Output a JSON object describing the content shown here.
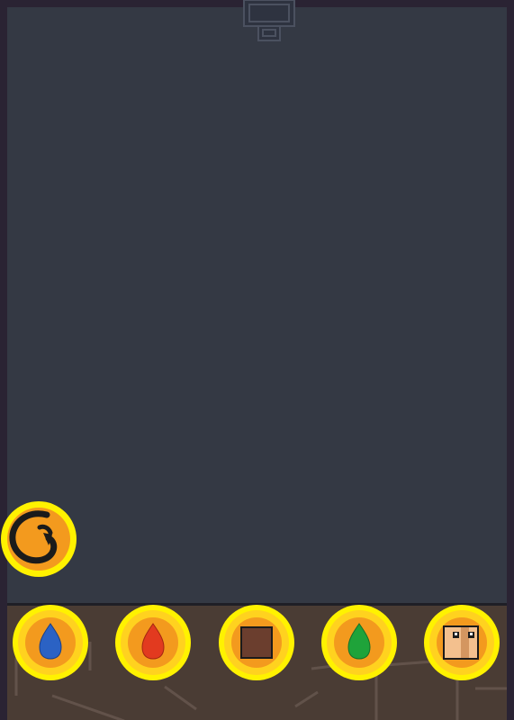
{
  "colors": {
    "frame": "#2a2333",
    "sky": "#343944",
    "ground": "#4a3c34",
    "ground_edge": "#1f1f26",
    "crack": "#6a5a52",
    "coin_outer": "#fff200",
    "coin_ring": "#ffd21f",
    "coin_inner": "#f39a1e",
    "outline": "#1b1b1b",
    "drop_blue": "#2b62c4",
    "drop_red": "#e23a1f",
    "drop_green": "#1fa33a",
    "block_brown": "#6b3e2e",
    "face_skin": "#f3c08e",
    "face_shade": "#d49660"
  },
  "hud": {
    "undo_icon": "undo-swirl-icon"
  },
  "hotbar": {
    "items": [
      {
        "icon": "water-drop-icon",
        "color": "#2b62c4"
      },
      {
        "icon": "fire-drop-icon",
        "color": "#e23a1f"
      },
      {
        "icon": "dirt-block-icon",
        "color": "#6b3e2e"
      },
      {
        "icon": "plant-seed-icon",
        "color": "#1fa33a"
      },
      {
        "icon": "character-face-icon",
        "color": "#f3c08e"
      }
    ]
  }
}
